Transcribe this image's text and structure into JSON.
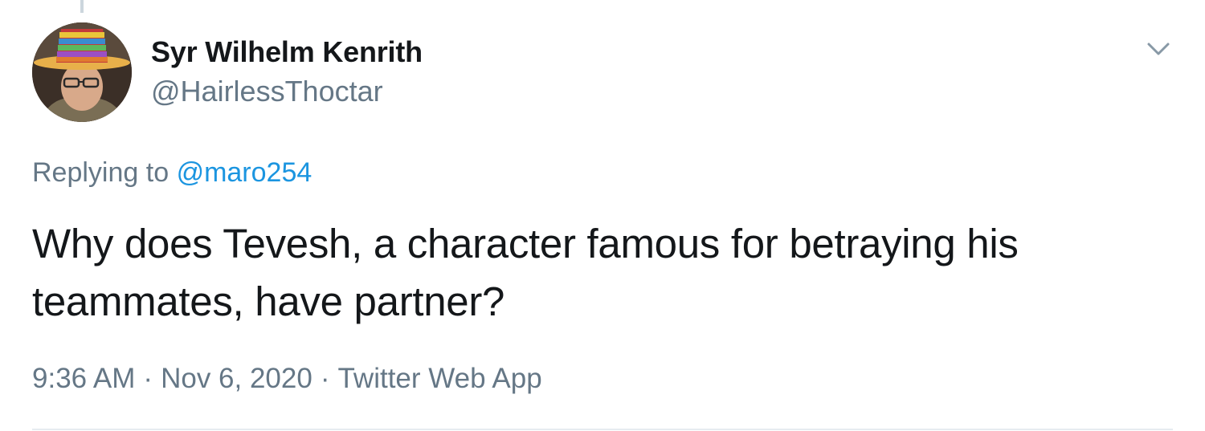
{
  "author": {
    "name": "Syr Wilhelm Kenrith",
    "handle": "@HairlessThoctar",
    "avatar_icon": "profile-photo"
  },
  "reply": {
    "prefix": "Replying to",
    "mention": "@maro254"
  },
  "tweet": {
    "text": "Why does Tevesh, a character famous for betraying his teammates, have partner?"
  },
  "meta": {
    "time": "9:36 AM",
    "separator": "·",
    "date": "Nov 6, 2020",
    "source": "Twitter Web App"
  },
  "icons": {
    "menu": "chevron-down-icon"
  },
  "colors": {
    "text": "#14171a",
    "secondary": "#657786",
    "link": "#1b95e0",
    "divider": "#e6ecf0"
  }
}
